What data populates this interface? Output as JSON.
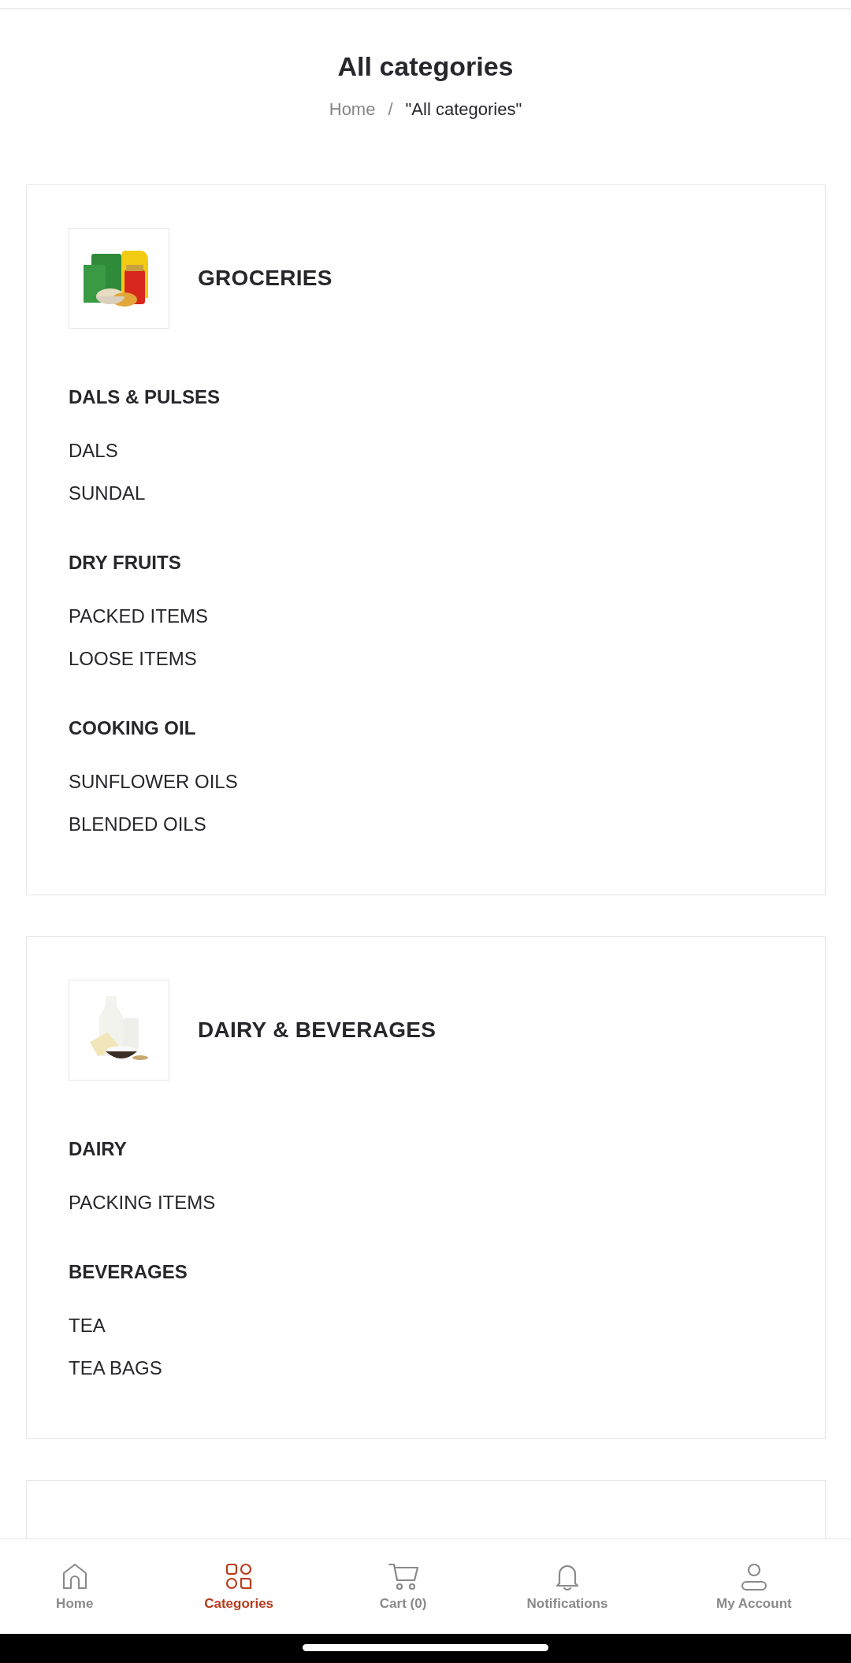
{
  "page_title": "All categories",
  "breadcrumb": {
    "home": "Home",
    "separator": "/",
    "current": "\"All categories\""
  },
  "categories": [
    {
      "name": "GROCERIES",
      "image": {
        "kind": "picture"
      },
      "groups": [
        {
          "title": "DALS & PULSES",
          "items": [
            "DALS",
            "SUNDAL"
          ]
        },
        {
          "title": "DRY FRUITS",
          "items": [
            "PACKED ITEMS",
            "LOOSE ITEMS"
          ]
        },
        {
          "title": "COOKING OIL",
          "items": [
            "SUNFLOWER OILS",
            "BLENDED OILS"
          ]
        }
      ]
    },
    {
      "name": "DAIRY & BEVERAGES",
      "image": {
        "kind": "picture"
      },
      "groups": [
        {
          "title": "DAIRY",
          "items": [
            "PACKING ITEMS"
          ]
        },
        {
          "title": "BEVERAGES",
          "items": [
            "TEA",
            "TEA BAGS"
          ]
        }
      ]
    }
  ],
  "bottom_nav": [
    {
      "label": "Home",
      "selected": false
    },
    {
      "label": "Categories",
      "selected": true
    },
    {
      "label": "Cart (0)",
      "selected": false
    },
    {
      "label": "Notifications",
      "selected": false
    },
    {
      "label": "My Account",
      "selected": false
    }
  ]
}
